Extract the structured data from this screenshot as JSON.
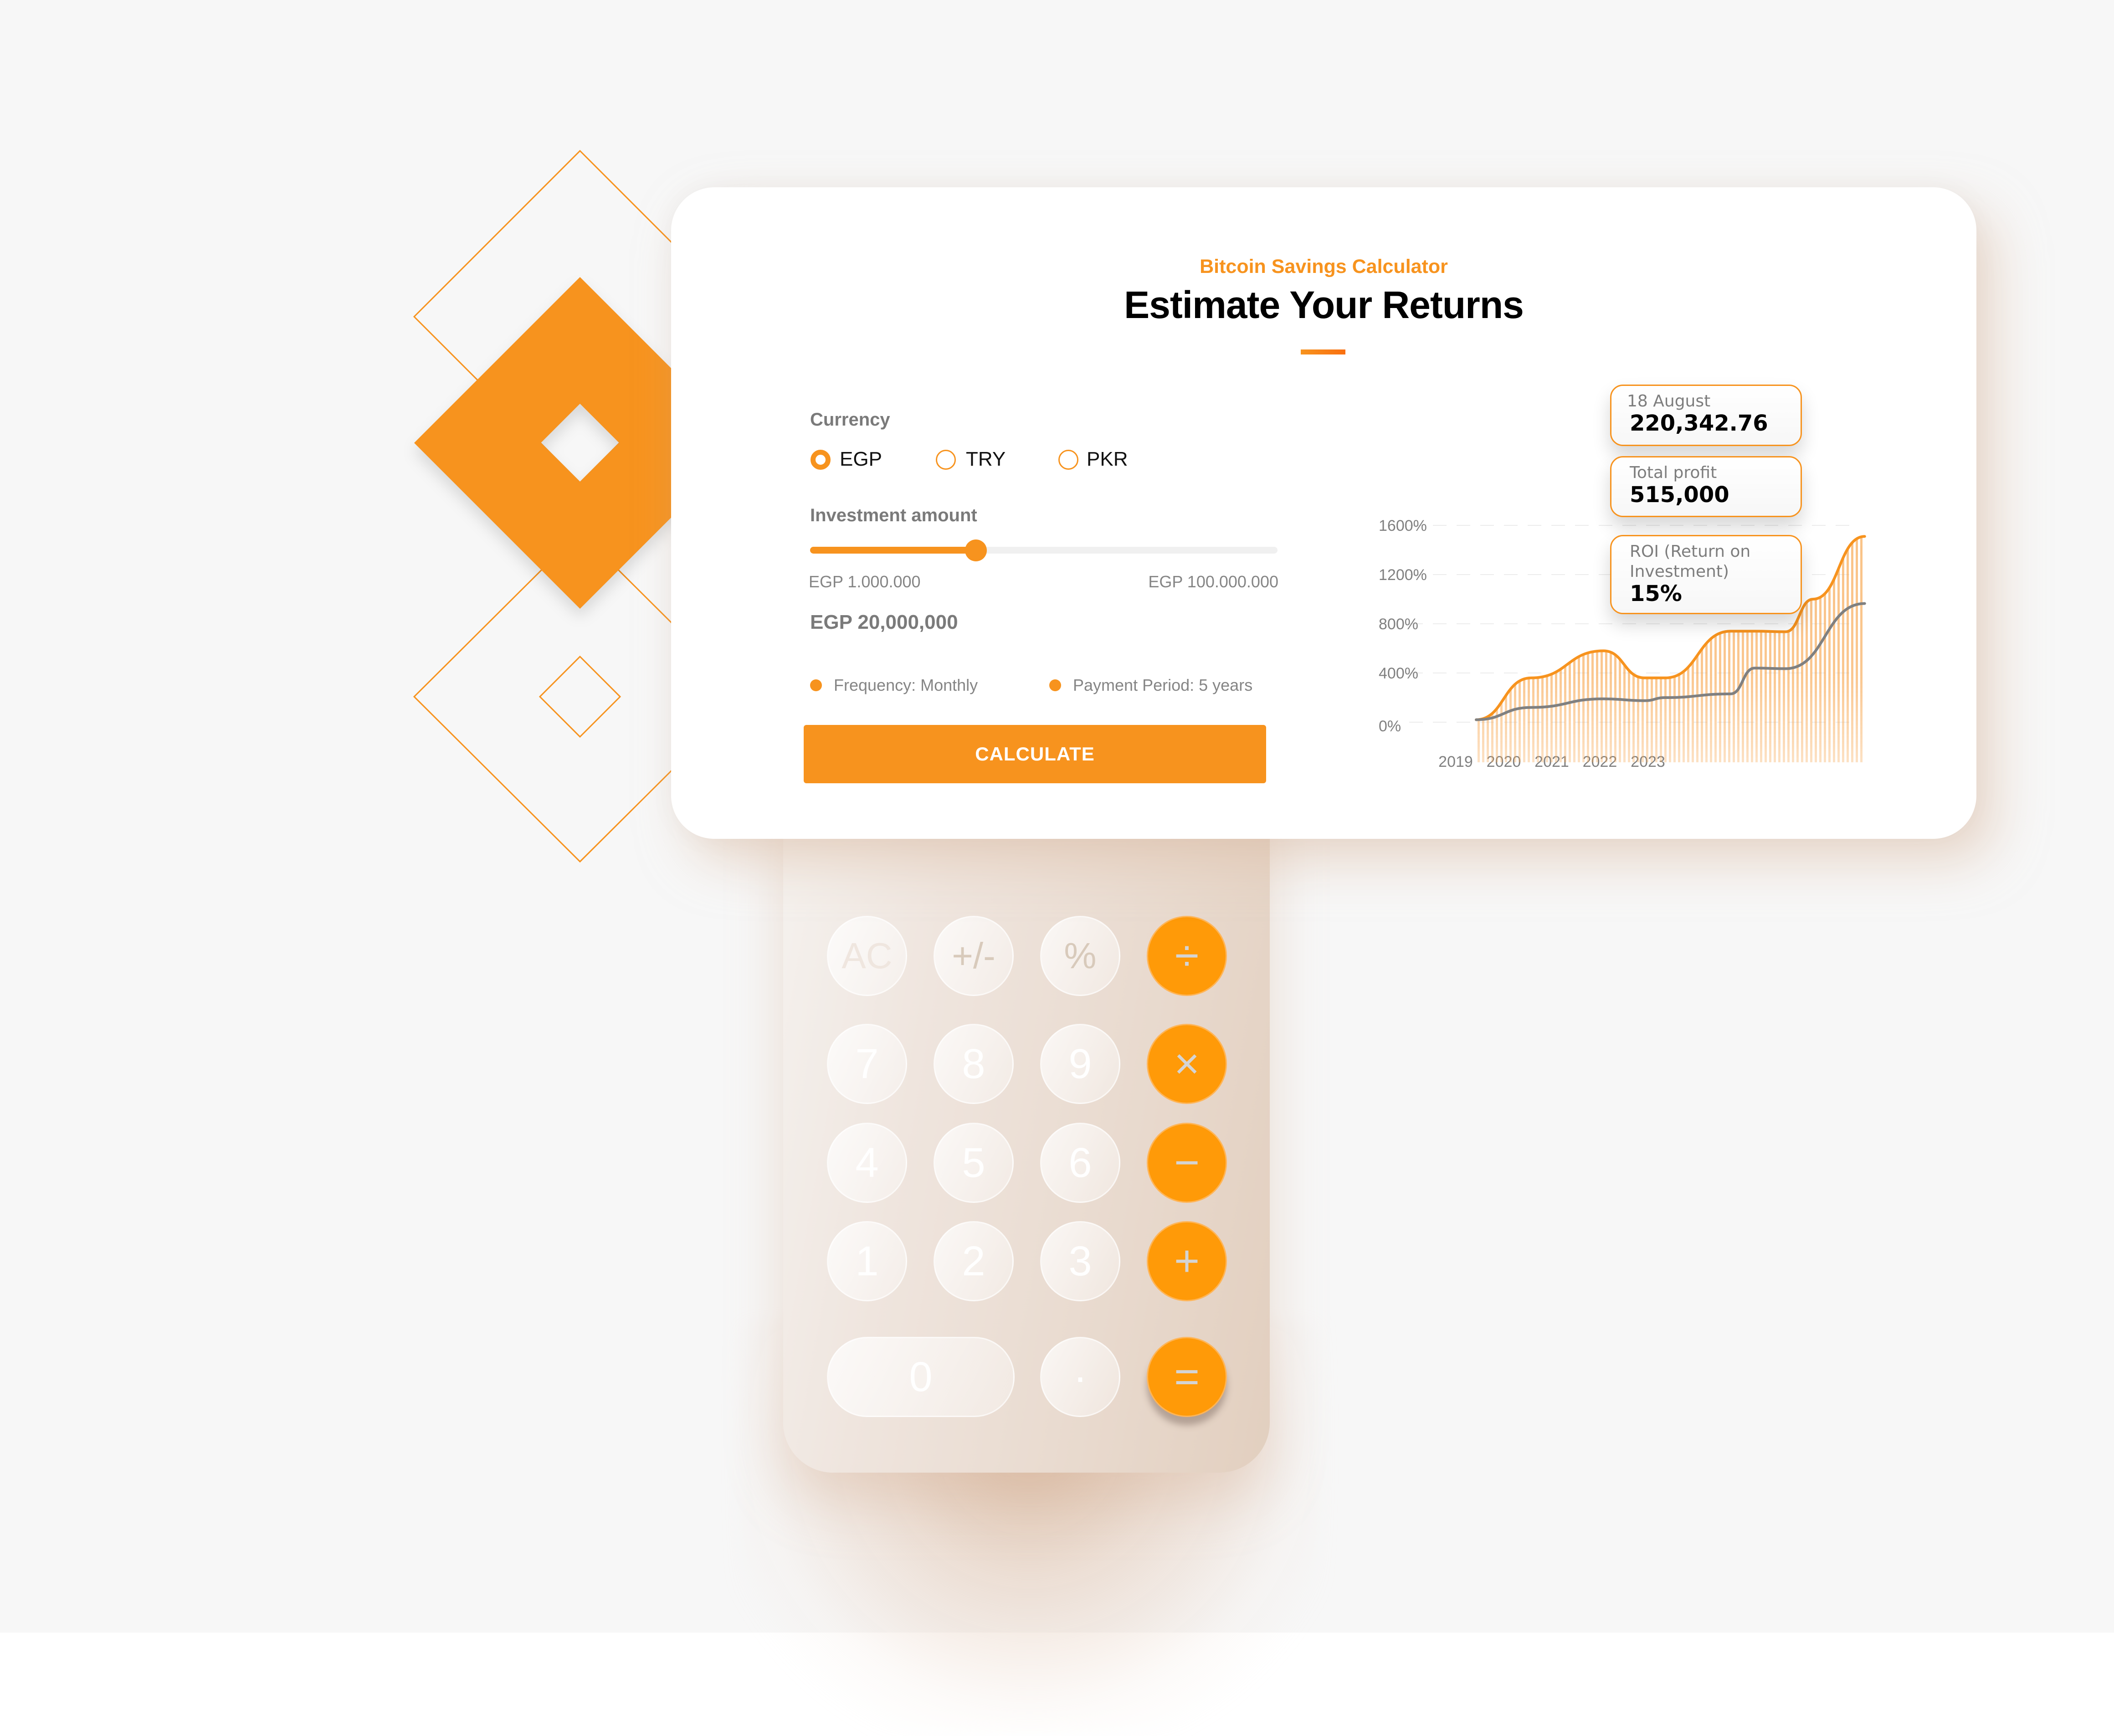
{
  "colors": {
    "accent": "#f7931e",
    "accent_dark": "#f96f10",
    "operator_key": "#ff9a08",
    "text_dark": "#000000",
    "text_muted": "#7a7a7a",
    "gray_series": "#808080",
    "background": "#f7f7f7"
  },
  "header": {
    "eyebrow": "Bitcoin Savings Calculator",
    "title": "Estimate Your Returns"
  },
  "form": {
    "currency_label": "Currency",
    "currency_options": [
      {
        "label": "EGP",
        "checked": true
      },
      {
        "label": "TRY",
        "checked": false
      },
      {
        "label": "PKR",
        "checked": false
      }
    ],
    "investment_label": "Investment amount",
    "slider": {
      "min_label": "EGP 1.000.000",
      "max_label": "EGP 100.000.000",
      "fraction": 0.355
    },
    "amount_value": "EGP 20,000,000",
    "frequency": "Frequency: Monthly",
    "payment_period": "Payment Period: 5 years",
    "calculate_label": "CALCULATE"
  },
  "tooltips": [
    {
      "label": "18 August",
      "value": "220,342.76"
    },
    {
      "label": "Total profit",
      "value": "515,000"
    },
    {
      "label": "ROI (Return on Investment)",
      "value": "15%"
    }
  ],
  "chart_data": {
    "type": "area",
    "title": "",
    "xlabel": "",
    "ylabel": "",
    "x_tick_labels": [
      "2019",
      "2020",
      "2021",
      "2022",
      "2023"
    ],
    "y_tick_labels": [
      "1600%",
      "1200%",
      "800%",
      "400%",
      "0%"
    ],
    "y_ticks": [
      1600,
      1200,
      800,
      400,
      0
    ],
    "ylim": [
      0,
      1600
    ],
    "xlim": [
      2019,
      2024.5
    ],
    "grid": true,
    "legend": "none",
    "series": [
      {
        "name": "projected_returns",
        "style": "orange line with hatched fill",
        "x": [
          2019.1,
          2019.9,
          2020.95,
          2021.55,
          2021.85,
          2022.8,
          2023.15,
          2023.6,
          2024.0,
          2024.75
        ],
        "values": [
          20,
          360,
          580,
          360,
          360,
          740,
          740,
          735,
          1000,
          1510
        ]
      },
      {
        "name": "invested_baseline",
        "style": "gray line",
        "x": [
          2019.1,
          2019.9,
          2020.95,
          2021.55,
          2021.85,
          2022.8,
          2023.15,
          2023.6,
          2024.75
        ],
        "values": [
          20,
          120,
          190,
          175,
          200,
          230,
          440,
          435,
          965
        ]
      }
    ]
  },
  "calculator": {
    "rows": [
      [
        {
          "label": "AC",
          "kind": "fn ac"
        },
        {
          "label": "+/-",
          "kind": "fn"
        },
        {
          "label": "%",
          "kind": "fn"
        },
        {
          "label": "÷",
          "kind": "op"
        }
      ],
      [
        {
          "label": "7",
          "kind": "num"
        },
        {
          "label": "8",
          "kind": "num"
        },
        {
          "label": "9",
          "kind": "num"
        },
        {
          "label": "×",
          "kind": "op"
        }
      ],
      [
        {
          "label": "4",
          "kind": "num"
        },
        {
          "label": "5",
          "kind": "num"
        },
        {
          "label": "6",
          "kind": "num"
        },
        {
          "label": "−",
          "kind": "op"
        }
      ],
      [
        {
          "label": "1",
          "kind": "num"
        },
        {
          "label": "2",
          "kind": "num"
        },
        {
          "label": "3",
          "kind": "num"
        },
        {
          "label": "+",
          "kind": "op"
        }
      ],
      [
        {
          "label": "0",
          "kind": "num zero"
        },
        {
          "label": "·",
          "kind": "num"
        },
        {
          "label": "=",
          "kind": "op eq"
        }
      ]
    ]
  },
  "icons": {
    "divide": "divide-icon",
    "multiply": "multiply-icon",
    "minus": "minus-icon",
    "plus": "plus-icon",
    "equals": "equals-icon",
    "decoration": "diamond-logo"
  }
}
